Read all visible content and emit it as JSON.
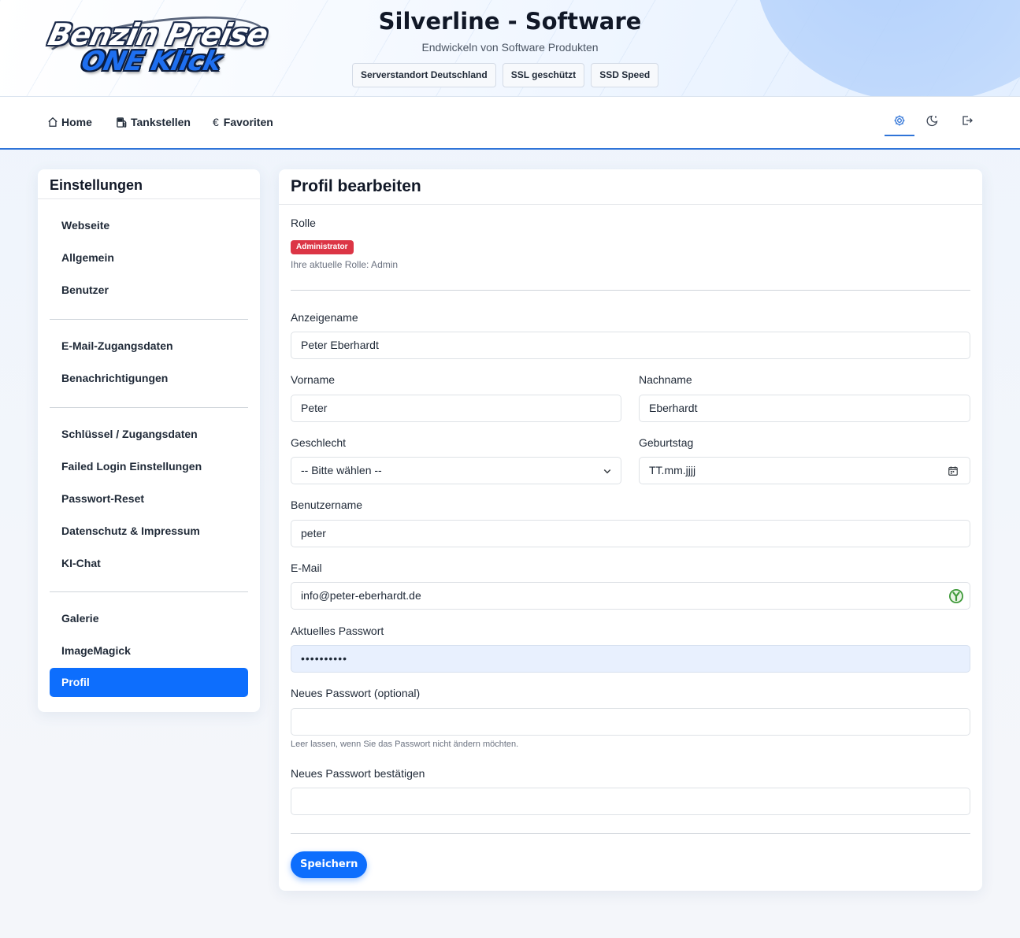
{
  "header": {
    "logo_line1": "Benzin Preise",
    "logo_line2": "ONE Klick",
    "title": "Silverline - Software",
    "subtitle": "Endwickeln von Software Produkten",
    "badges": [
      "Serverstandort Deutschland",
      "SSL geschützt",
      "SSD Speed"
    ]
  },
  "nav": {
    "home": "Home",
    "tankstellen": "Tankstellen",
    "favoriten": "Favoriten",
    "favoriten_symbol": "€",
    "icons": [
      "gear-icon",
      "moon-icon",
      "logout-icon"
    ]
  },
  "sidebar": {
    "title": "Einstellungen",
    "groups": [
      [
        "Webseite",
        "Allgemein",
        "Benutzer"
      ],
      [
        "E-Mail-Zugangsdaten",
        "Benachrichtigungen"
      ],
      [
        "Schlüssel / Zugangsdaten",
        "Failed Login Einstellungen",
        "Passwort-Reset",
        "Datenschutz & Impressum",
        "KI-Chat"
      ],
      [
        "Galerie",
        "ImageMagick",
        "Profil"
      ]
    ],
    "active": "Profil"
  },
  "profile": {
    "title": "Profil bearbeiten",
    "role_label": "Rolle",
    "role_badge": "Administrator",
    "role_help": "Ihre aktuelle Rolle: Admin",
    "display_name_label": "Anzeigename",
    "display_name_value": "Peter Eberhardt",
    "firstname_label": "Vorname",
    "firstname_value": "Peter",
    "lastname_label": "Nachname",
    "lastname_value": "Eberhardt",
    "gender_label": "Geschlecht",
    "gender_value": "-- Bitte wählen --",
    "birthday_label": "Geburtstag",
    "birthday_placeholder": "TT.mm.jjjj",
    "username_label": "Benutzername",
    "username_value": "peter",
    "email_label": "E-Mail",
    "email_value": "info@peter-eberhardt.de",
    "current_password_label": "Aktuelles Passwort",
    "current_password_value": "••••••••••",
    "new_password_label": "Neues Passwort (optional)",
    "new_password_value": "",
    "new_password_help": "Leer lassen, wenn Sie das Passwort nicht ändern möchten.",
    "confirm_password_label": "Neues Passwort bestätigen",
    "confirm_password_value": "",
    "save_label": "Speichern"
  },
  "colors": {
    "primary": "#0d6efd",
    "danger": "#dc3545",
    "nav_accent": "#2f74d8"
  }
}
